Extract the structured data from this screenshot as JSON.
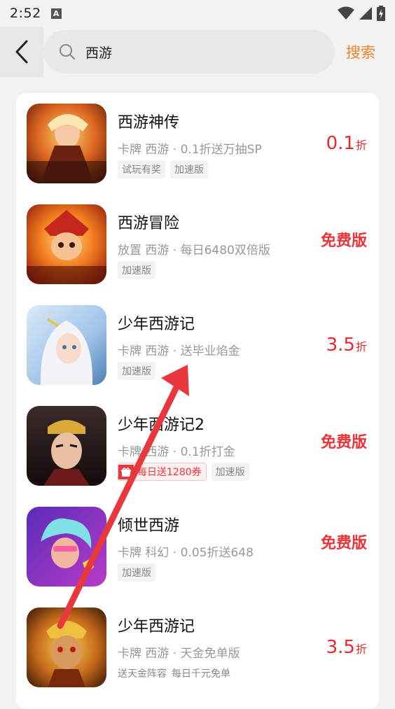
{
  "status_bar": {
    "time": "2:52",
    "a_label": "A"
  },
  "search": {
    "value": "西游",
    "button_label": "搜索"
  },
  "colors": {
    "accent": "#f2812b",
    "discount_red": "#e8282d",
    "arrow_red": "#e8383d"
  },
  "games": [
    {
      "name": "西游神传",
      "desc": "卡牌 西游 · 0.1折送万抽SP",
      "tags": [
        "试玩有奖",
        "加速版"
      ],
      "discount_num": "0.1",
      "discount_unit": "折",
      "free_label": ""
    },
    {
      "name": "西游冒险",
      "desc": "放置 西游 · 每日6480双倍版",
      "tags": [
        "加速版"
      ],
      "discount_num": "",
      "discount_unit": "",
      "free_label": "免费版"
    },
    {
      "name": "少年西游记",
      "desc": "卡牌 西游 · 送毕业焰金",
      "tags": [
        "加速版"
      ],
      "discount_num": "3.5",
      "discount_unit": "折",
      "free_label": ""
    },
    {
      "name": "少年西游记2",
      "desc": "卡牌 西游 · 0.1折打金",
      "red_tag": "每日送1280券",
      "tags": [
        "加速版"
      ],
      "discount_num": "",
      "discount_unit": "",
      "free_label": "免费版"
    },
    {
      "name": "倾世西游",
      "desc": "卡牌 科幻 · 0.05折送648",
      "tags": [
        "加速版"
      ],
      "discount_num": "",
      "discount_unit": "",
      "free_label": "免费版"
    },
    {
      "name": "少年西游记",
      "desc": "卡牌 西游 · 天金免单版",
      "plain_tags": [
        "送天金阵容",
        "每日千元免单"
      ],
      "discount_num": "3.5",
      "discount_unit": "折",
      "free_label": ""
    }
  ]
}
